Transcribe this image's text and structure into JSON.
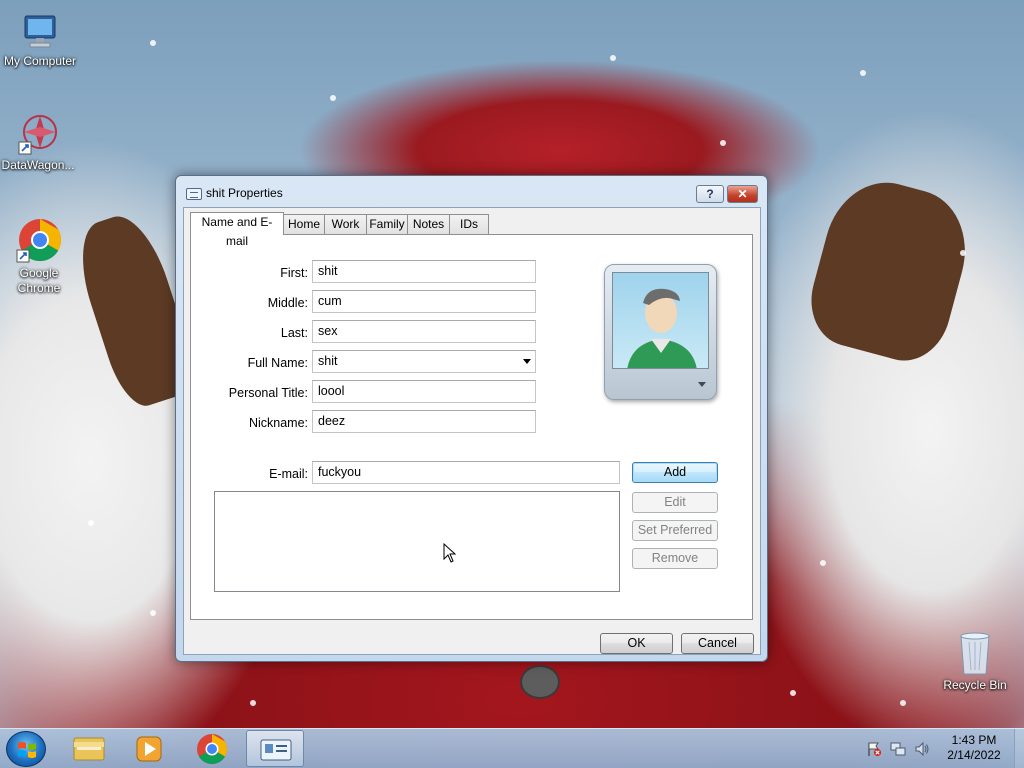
{
  "desktop": {
    "icons": [
      {
        "label": "My Computer",
        "icon": "computer-icon"
      },
      {
        "label": "DataWagon...",
        "icon": "datawagon-shortcut-icon"
      },
      {
        "label": "Google Chrome",
        "icon": "chrome-shortcut-icon"
      },
      {
        "label": "Recycle Bin",
        "icon": "recycle-bin-icon"
      }
    ]
  },
  "window": {
    "title": "shit Properties",
    "help_label": "?",
    "close_label": "✕",
    "tabs": [
      {
        "label": "Name and E-mail",
        "active": true
      },
      {
        "label": "Home"
      },
      {
        "label": "Work"
      },
      {
        "label": "Family"
      },
      {
        "label": "Notes"
      },
      {
        "label": "IDs"
      }
    ],
    "fields": {
      "first": {
        "label": "First:",
        "value": "shit"
      },
      "middle": {
        "label": "Middle:",
        "value": "cum"
      },
      "last": {
        "label": "Last:",
        "value": "sex"
      },
      "full_name": {
        "label": "Full Name:",
        "value": "shit"
      },
      "personal_title": {
        "label": "Personal Title:",
        "value": "loool"
      },
      "nickname": {
        "label": "Nickname:",
        "value": "deez"
      },
      "email": {
        "label": "E-mail:",
        "value": "fuckyou"
      }
    },
    "email_buttons": {
      "add": "Add",
      "edit": "Edit",
      "set_preferred": "Set Preferred",
      "remove": "Remove"
    },
    "footer": {
      "ok": "OK",
      "cancel": "Cancel"
    }
  },
  "taskbar": {
    "apps": [
      "file-explorer-icon",
      "media-player-icon",
      "chrome-icon",
      "contacts-properties-icon"
    ],
    "time": "1:43 PM",
    "date": "2/14/2022"
  },
  "colors": {
    "accent": "#3c7fb1",
    "close_button": "#c4402a"
  }
}
